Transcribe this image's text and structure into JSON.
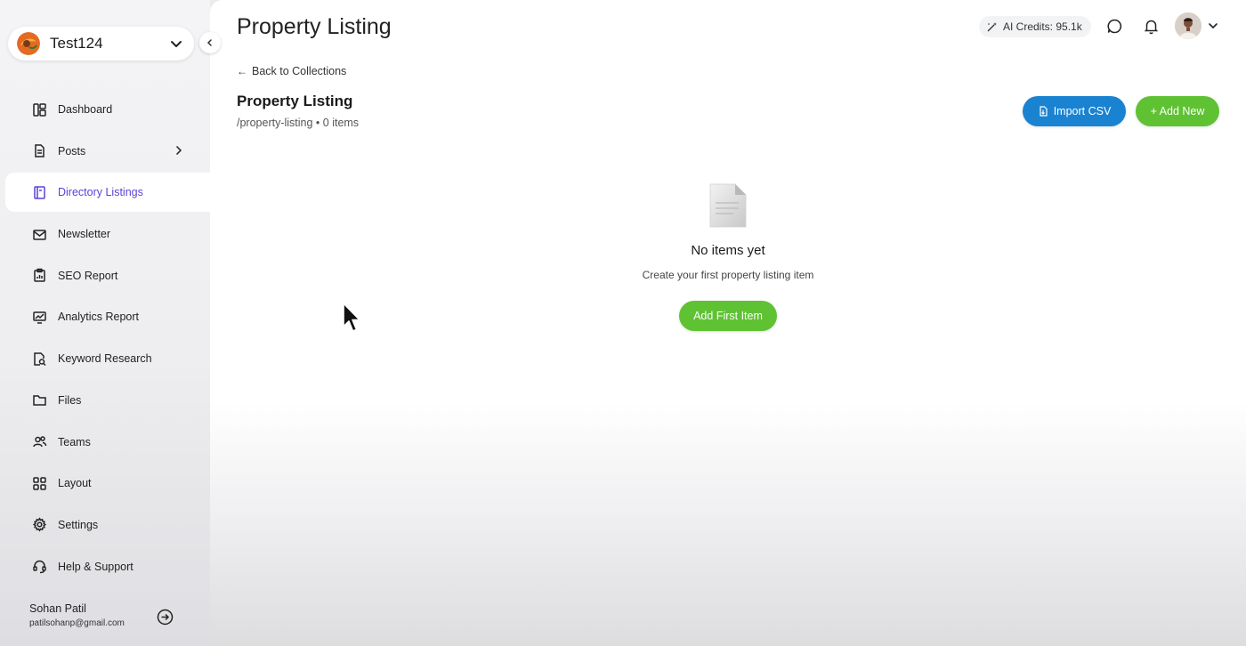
{
  "workspace": {
    "name": "Test124"
  },
  "sidebar": {
    "items": [
      {
        "label": "Dashboard",
        "icon": "dashboard-icon"
      },
      {
        "label": "Posts",
        "icon": "document-icon"
      },
      {
        "label": "Directory Listings",
        "icon": "book-icon"
      },
      {
        "label": "Newsletter",
        "icon": "mail-icon"
      },
      {
        "label": "SEO Report",
        "icon": "clipboard-chart-icon"
      },
      {
        "label": "Analytics Report",
        "icon": "monitor-chart-icon"
      },
      {
        "label": "Keyword Research",
        "icon": "file-search-icon"
      },
      {
        "label": "Files",
        "icon": "folder-icon"
      },
      {
        "label": "Teams",
        "icon": "users-icon"
      },
      {
        "label": "Layout",
        "icon": "grid-icon"
      },
      {
        "label": "Settings",
        "icon": "gear-icon"
      },
      {
        "label": "Help & Support",
        "icon": "headset-icon"
      }
    ],
    "active": "Directory Listings"
  },
  "user": {
    "name": "Sohan Patil",
    "email": "patilsohanp@gmail.com"
  },
  "header": {
    "title": "Property Listing",
    "credits": "AI Credits: 95.1k"
  },
  "collection": {
    "back_label": "Back to Collections",
    "title": "Property Listing",
    "meta": "/property-listing • 0 items",
    "import_label": "Import CSV",
    "add_label": "+ Add New"
  },
  "empty": {
    "title": "No items yet",
    "subtitle": "Create your first property listing item",
    "button_label": "Add First Item"
  },
  "colors": {
    "accent": "#5b42d8",
    "blue": "#1a83d1",
    "green": "#5fc233"
  }
}
